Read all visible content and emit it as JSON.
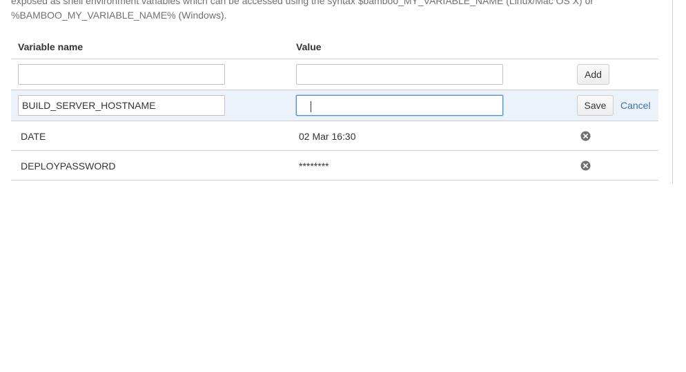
{
  "description": {
    "line1": "exposed as shell environment variables which can be accessed using the syntax $bamboo_MY_VARIABLE_NAME (Linux/Mac OS X) or",
    "line2": "%BAMBOO_MY_VARIABLE_NAME% (Windows)."
  },
  "table": {
    "headers": {
      "name": "Variable name",
      "value": "Value"
    },
    "add_row": {
      "name_value": "",
      "value_value": "",
      "add_label": "Add"
    },
    "edit_row": {
      "name_value": "BUILD_SERVER_HOSTNAME",
      "value_value": "",
      "save_label": "Save",
      "cancel_label": "Cancel"
    },
    "rows": [
      {
        "name": "DATE",
        "value": "02 Mar 16:30",
        "action_icon": "remove-circle-icon"
      },
      {
        "name": "DEPLOYPASSWORD",
        "value": "********",
        "action_icon": "remove-circle-icon"
      }
    ]
  },
  "colors": {
    "edit_row_bg": "#ebf2f9",
    "link": "#3b73af",
    "focus": "#4a90d9",
    "icon": "#707070"
  }
}
